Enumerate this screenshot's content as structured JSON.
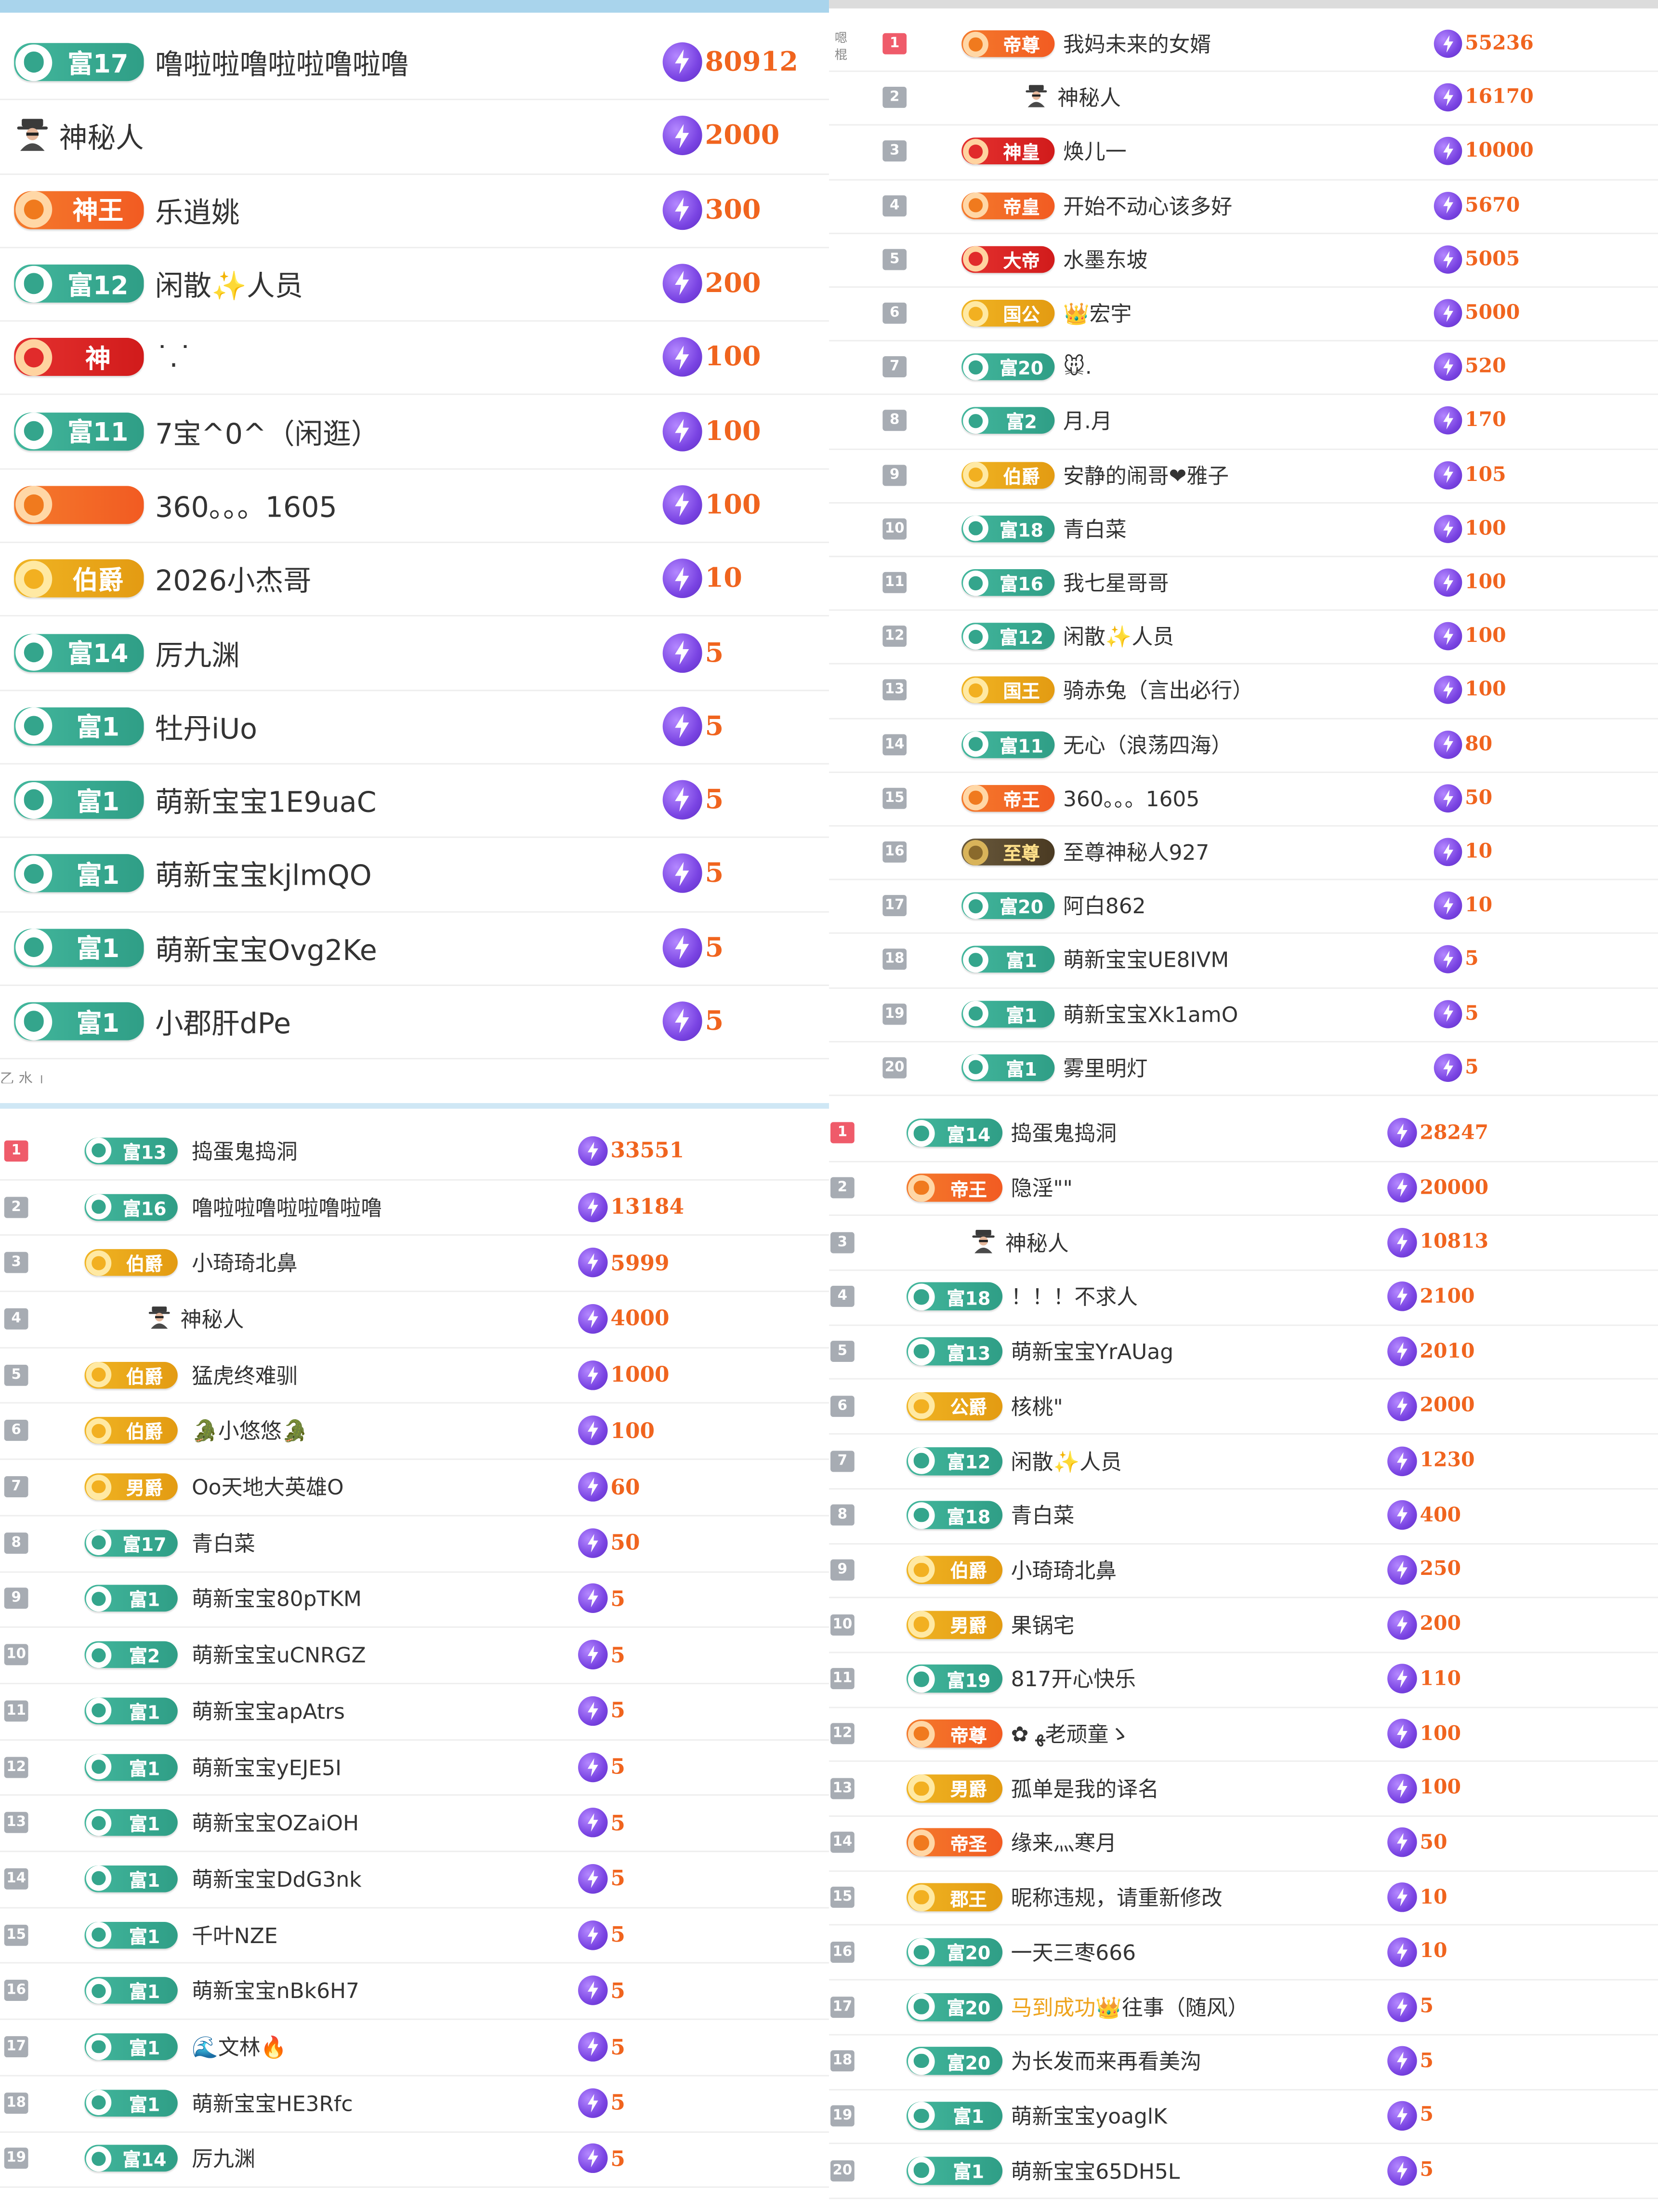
{
  "panels": [
    {
      "id": "p1",
      "has_rank": false,
      "rows": [
        {
          "badge": "富17",
          "badge_color": "green",
          "name": "噜啦啦噜啦啦噜啦噜",
          "amount": "80912"
        },
        {
          "badge": "",
          "badge_color": "none",
          "avatar": "mystery-person-icon",
          "name": "神秘人",
          "amount": "2000"
        },
        {
          "badge": "神王",
          "badge_color": "orange",
          "name": "乐逍姚",
          "amount": "300"
        },
        {
          "badge": "富12",
          "badge_color": "green",
          "name": "闲散✨人员",
          "amount": "200"
        },
        {
          "badge": "神",
          "badge_color": "red",
          "name": "˙.˙",
          "amount": "100"
        },
        {
          "badge": "富11",
          "badge_color": "green",
          "name": "7宝^0^（闲逛）",
          "amount": "100"
        },
        {
          "badge": "",
          "badge_color": "orange",
          "name": "360。。。1605",
          "amount": "100"
        },
        {
          "badge": "伯爵",
          "badge_color": "gold",
          "name": "2026小杰哥",
          "amount": "10"
        },
        {
          "badge": "富14",
          "badge_color": "green",
          "name": "厉九渊",
          "amount": "5"
        },
        {
          "badge": "富1",
          "badge_color": "green",
          "name": "牡丹iUo",
          "amount": "5"
        },
        {
          "badge": "富1",
          "badge_color": "green",
          "name": "萌新宝宝1E9uaC",
          "amount": "5"
        },
        {
          "badge": "富1",
          "badge_color": "green",
          "name": "萌新宝宝kjlmQO",
          "amount": "5"
        },
        {
          "badge": "富1",
          "badge_color": "green",
          "name": "萌新宝宝Ovg2Ke",
          "amount": "5"
        },
        {
          "badge": "富1",
          "badge_color": "green",
          "name": "小郡肝dPe",
          "amount": "5"
        }
      ]
    },
    {
      "id": "p2",
      "has_rank": true,
      "rows": [
        {
          "rank": "1",
          "badge": "帝尊",
          "badge_color": "orange",
          "name": "我妈未来的女婿",
          "amount": "55236"
        },
        {
          "rank": "2",
          "badge": "",
          "badge_color": "none",
          "avatar": "mystery-person-icon",
          "name": "神秘人",
          "amount": "16170"
        },
        {
          "rank": "3",
          "badge": "神皇",
          "badge_color": "red",
          "name": "焕儿一",
          "amount": "10000"
        },
        {
          "rank": "4",
          "badge": "帝皇",
          "badge_color": "orange",
          "name": "开始不动心该多好",
          "amount": "5670"
        },
        {
          "rank": "5",
          "badge": "大帝",
          "badge_color": "red",
          "name": "水墨东坡",
          "amount": "5005"
        },
        {
          "rank": "6",
          "badge": "国公",
          "badge_color": "gold",
          "name": "👑宏宇",
          "amount": "5000"
        },
        {
          "rank": "7",
          "badge": "富20",
          "badge_color": "green",
          "name": "🐭.",
          "amount": "520"
        },
        {
          "rank": "8",
          "badge": "富2",
          "badge_color": "green",
          "name": "月.月",
          "amount": "170"
        },
        {
          "rank": "9",
          "badge": "伯爵",
          "badge_color": "gold",
          "name": "安静的闹哥❤雅子",
          "amount": "105"
        },
        {
          "rank": "10",
          "badge": "富18",
          "badge_color": "green",
          "name": "青白菜",
          "amount": "100"
        },
        {
          "rank": "11",
          "badge": "富16",
          "badge_color": "green",
          "name": "我七星哥哥",
          "amount": "100"
        },
        {
          "rank": "12",
          "badge": "富12",
          "badge_color": "green",
          "name": "闲散✨人员",
          "amount": "100"
        },
        {
          "rank": "13",
          "badge": "国王",
          "badge_color": "gold",
          "name": "骑赤兔（言出必行）",
          "amount": "100"
        },
        {
          "rank": "14",
          "badge": "富11",
          "badge_color": "green",
          "name": "无心（浪荡四海）",
          "amount": "80"
        },
        {
          "rank": "15",
          "badge": "帝王",
          "badge_color": "orange",
          "name": "360。。。1605",
          "amount": "50"
        },
        {
          "rank": "16",
          "badge": "至尊",
          "badge_color": "dark",
          "name": "至尊神秘人927",
          "amount": "10"
        },
        {
          "rank": "17",
          "badge": "富20",
          "badge_color": "green",
          "name": "阿白862",
          "amount": "10"
        },
        {
          "rank": "18",
          "badge": "富1",
          "badge_color": "green",
          "name": "萌新宝宝UE8IVM",
          "amount": "5"
        },
        {
          "rank": "19",
          "badge": "富1",
          "badge_color": "green",
          "name": "萌新宝宝Xk1amO",
          "amount": "5"
        },
        {
          "rank": "20",
          "badge": "富1",
          "badge_color": "green",
          "name": "雾里明灯",
          "amount": "5"
        }
      ]
    },
    {
      "id": "p3",
      "has_rank": true,
      "rows": [
        {
          "rank": "1",
          "badge": "富13",
          "badge_color": "green",
          "name": "捣蛋鬼捣洞",
          "amount": "33551"
        },
        {
          "rank": "2",
          "badge": "富16",
          "badge_color": "green",
          "name": "噜啦啦噜啦啦噜啦噜",
          "amount": "13184"
        },
        {
          "rank": "3",
          "badge": "伯爵",
          "badge_color": "gold",
          "name": "小琦琦北鼻",
          "amount": "5999"
        },
        {
          "rank": "4",
          "badge": "",
          "badge_color": "none",
          "avatar": "mystery-person-icon",
          "name": "神秘人",
          "amount": "4000"
        },
        {
          "rank": "5",
          "badge": "伯爵",
          "badge_color": "gold",
          "name": "猛虎终难驯",
          "amount": "1000"
        },
        {
          "rank": "6",
          "badge": "伯爵",
          "badge_color": "gold",
          "name": "🐊小悠悠🐊",
          "amount": "100"
        },
        {
          "rank": "7",
          "badge": "男爵",
          "badge_color": "gold",
          "name": "Oo天地大英雄O",
          "amount": "60"
        },
        {
          "rank": "8",
          "badge": "富17",
          "badge_color": "green",
          "name": "青白菜",
          "amount": "50"
        },
        {
          "rank": "9",
          "badge": "富1",
          "badge_color": "green",
          "name": "萌新宝宝80pTKM",
          "amount": "5"
        },
        {
          "rank": "10",
          "badge": "富2",
          "badge_color": "green",
          "name": "萌新宝宝uCNRGZ",
          "amount": "5"
        },
        {
          "rank": "11",
          "badge": "富1",
          "badge_color": "green",
          "name": "萌新宝宝apAtrs",
          "amount": "5"
        },
        {
          "rank": "12",
          "badge": "富1",
          "badge_color": "green",
          "name": "萌新宝宝yEJE5I",
          "amount": "5"
        },
        {
          "rank": "13",
          "badge": "富1",
          "badge_color": "green",
          "name": "萌新宝宝OZaiOH",
          "amount": "5"
        },
        {
          "rank": "14",
          "badge": "富1",
          "badge_color": "green",
          "name": "萌新宝宝DdG3nk",
          "amount": "5"
        },
        {
          "rank": "15",
          "badge": "富1",
          "badge_color": "green",
          "name": "千叶NZE",
          "amount": "5"
        },
        {
          "rank": "16",
          "badge": "富1",
          "badge_color": "green",
          "name": "萌新宝宝nBk6H7",
          "amount": "5"
        },
        {
          "rank": "17",
          "badge": "富1",
          "badge_color": "green",
          "name": "🌊文林🔥",
          "amount": "5"
        },
        {
          "rank": "18",
          "badge": "富1",
          "badge_color": "green",
          "name": "萌新宝宝HE3Rfc",
          "amount": "5"
        },
        {
          "rank": "19",
          "badge": "富14",
          "badge_color": "green",
          "name": "厉九渊",
          "amount": "5"
        }
      ]
    },
    {
      "id": "p4",
      "has_rank": true,
      "rows": [
        {
          "rank": "1",
          "badge": "富14",
          "badge_color": "green",
          "name": "捣蛋鬼捣洞",
          "amount": "28247"
        },
        {
          "rank": "2",
          "badge": "帝王",
          "badge_color": "orange",
          "name": "隐淫\"\"",
          "amount": "20000"
        },
        {
          "rank": "3",
          "badge": "",
          "badge_color": "none",
          "avatar": "mystery-person-icon",
          "name": "神秘人",
          "amount": "10813"
        },
        {
          "rank": "4",
          "badge": "富18",
          "badge_color": "green",
          "name": "！！！不求人",
          "amount": "2100"
        },
        {
          "rank": "5",
          "badge": "富13",
          "badge_color": "green",
          "name": "萌新宝宝YrAUag",
          "amount": "2010"
        },
        {
          "rank": "6",
          "badge": "公爵",
          "badge_color": "gold",
          "name": "核桃\"",
          "amount": "2000"
        },
        {
          "rank": "7",
          "badge": "富12",
          "badge_color": "green",
          "name": "闲散✨人员",
          "amount": "1230"
        },
        {
          "rank": "8",
          "badge": "富18",
          "badge_color": "green",
          "name": "青白菜",
          "amount": "400"
        },
        {
          "rank": "9",
          "badge": "伯爵",
          "badge_color": "gold",
          "name": "小琦琦北鼻",
          "amount": "250"
        },
        {
          "rank": "10",
          "badge": "男爵",
          "badge_color": "gold",
          "name": "果锅宅",
          "amount": "200"
        },
        {
          "rank": "11",
          "badge": "富19",
          "badge_color": "green",
          "name": "817开心快乐",
          "amount": "110"
        },
        {
          "rank": "12",
          "badge": "帝尊",
          "badge_color": "orange",
          "name": "✿ ﻬ老顽童ゝ",
          "amount": "100"
        },
        {
          "rank": "13",
          "badge": "男爵",
          "badge_color": "gold",
          "name": "孤单是我的译名",
          "amount": "100"
        },
        {
          "rank": "14",
          "badge": "帝圣",
          "badge_color": "orange",
          "name": "缘来灬寒月",
          "amount": "50"
        },
        {
          "rank": "15",
          "badge": "郡王",
          "badge_color": "gold",
          "name": "昵称违规，请重新修改",
          "amount": "10"
        },
        {
          "rank": "16",
          "badge": "富20",
          "badge_color": "green",
          "name": "一天三枣666",
          "amount": "10"
        },
        {
          "rank": "17",
          "badge": "富20",
          "badge_color": "green",
          "name": "马到成功👑往事（随风）",
          "name_gold_prefix": "马到成功",
          "amount": "5"
        },
        {
          "rank": "18",
          "badge": "富20",
          "badge_color": "green",
          "name": "为长发而来再看美沟",
          "amount": "5"
        },
        {
          "rank": "19",
          "badge": "富1",
          "badge_color": "green",
          "name": "萌新宝宝yoaglK",
          "amount": "5"
        },
        {
          "rank": "20",
          "badge": "富1",
          "badge_color": "green",
          "name": "萌新宝宝65DH5L",
          "amount": "5"
        }
      ]
    }
  ],
  "fragments": {
    "p1_bottom": "乙 水 」",
    "p1_side": "嗯 棍"
  },
  "colors": {
    "amount": "#f0641e",
    "coin": "#7a44e3",
    "rank_top": "#ef5b6a",
    "rank_other": "#a7acb3",
    "green_badge": "#34a58c",
    "gold_badge": "#f0b423",
    "orange_badge": "#f25b22",
    "red_badge": "#d11b1b"
  },
  "icons": {
    "coin": "lightning-coin-icon",
    "mystery": "mystery-person-icon"
  }
}
